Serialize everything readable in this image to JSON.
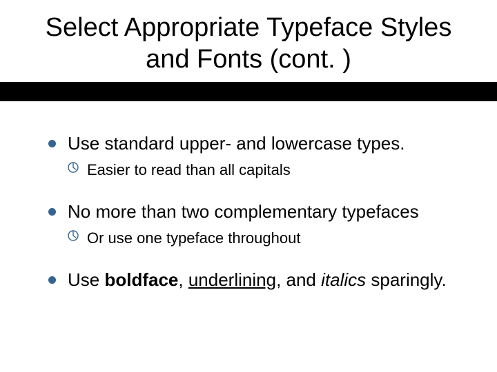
{
  "title": "Select Appropriate Typeface Styles and Fonts (cont. )",
  "bullets": {
    "b1": {
      "text": "Use standard upper- and lowercase types.",
      "sub": "Easier to read than all capitals"
    },
    "b2": {
      "text": "No more than two complementary typefaces",
      "sub": "Or use one typeface throughout"
    },
    "b3": {
      "prefix": "Use ",
      "bold": "boldface",
      "comma1": ", ",
      "underline": "underlining",
      "comma2": ", and ",
      "italic": "italics",
      "suffix": " sparingly."
    }
  }
}
